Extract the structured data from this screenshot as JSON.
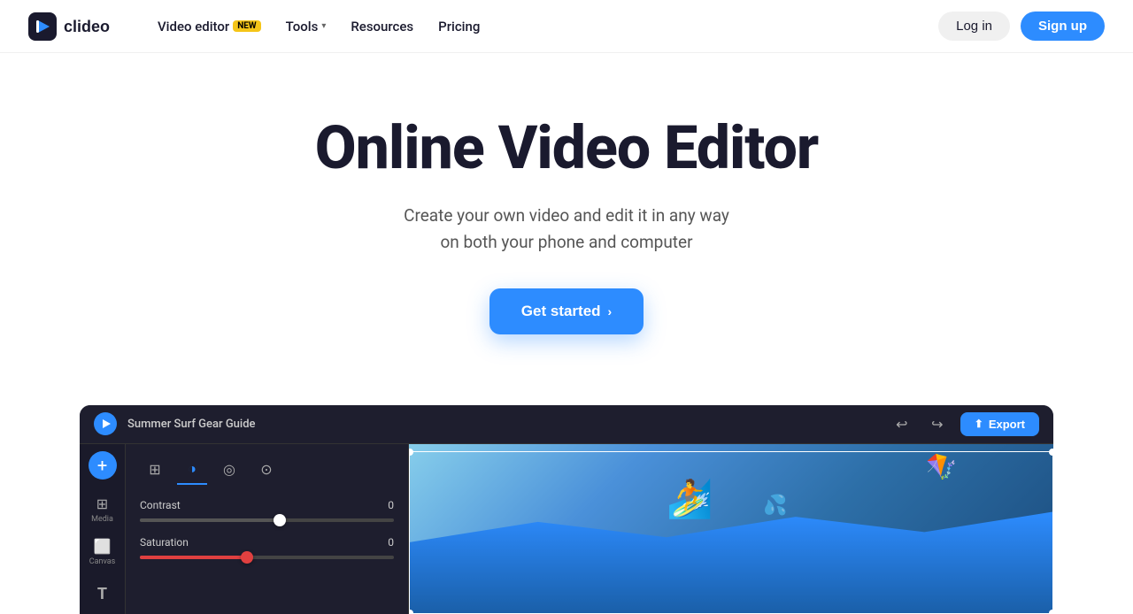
{
  "nav": {
    "logo_text": "clideo",
    "links": [
      {
        "id": "video-editor",
        "label": "Video editor",
        "badge": "NEW",
        "has_chevron": false
      },
      {
        "id": "tools",
        "label": "Tools",
        "has_chevron": true
      },
      {
        "id": "resources",
        "label": "Resources",
        "has_chevron": false
      },
      {
        "id": "pricing",
        "label": "Pricing",
        "has_chevron": false
      }
    ],
    "login_label": "Log in",
    "signup_label": "Sign up"
  },
  "hero": {
    "title": "Online Video Editor",
    "subtitle_line1": "Create your own video and edit it in any way",
    "subtitle_line2": "on both your phone and computer",
    "cta_label": "Get started"
  },
  "editor": {
    "filename": "Summer Surf Gear Guide",
    "export_label": "Export",
    "undo_icon": "↩",
    "redo_icon": "↪",
    "tools": [
      {
        "id": "media",
        "label": "Media",
        "icon": "⊞"
      },
      {
        "id": "canvas",
        "label": "Canvas",
        "icon": "⬜"
      }
    ],
    "panel_tabs": [
      {
        "id": "grid",
        "icon": "⊞",
        "active": false
      },
      {
        "id": "contrast",
        "icon": "◑",
        "active": true
      },
      {
        "id": "audio",
        "icon": "◎",
        "active": false
      },
      {
        "id": "motion",
        "icon": "⊙",
        "active": false
      }
    ],
    "sliders": [
      {
        "id": "contrast",
        "label": "Contrast",
        "value": 0,
        "fill_pct": 55,
        "color": "neutral"
      },
      {
        "id": "saturation",
        "label": "Saturation",
        "value": 0,
        "fill_pct": 42,
        "color": "red"
      }
    ]
  }
}
